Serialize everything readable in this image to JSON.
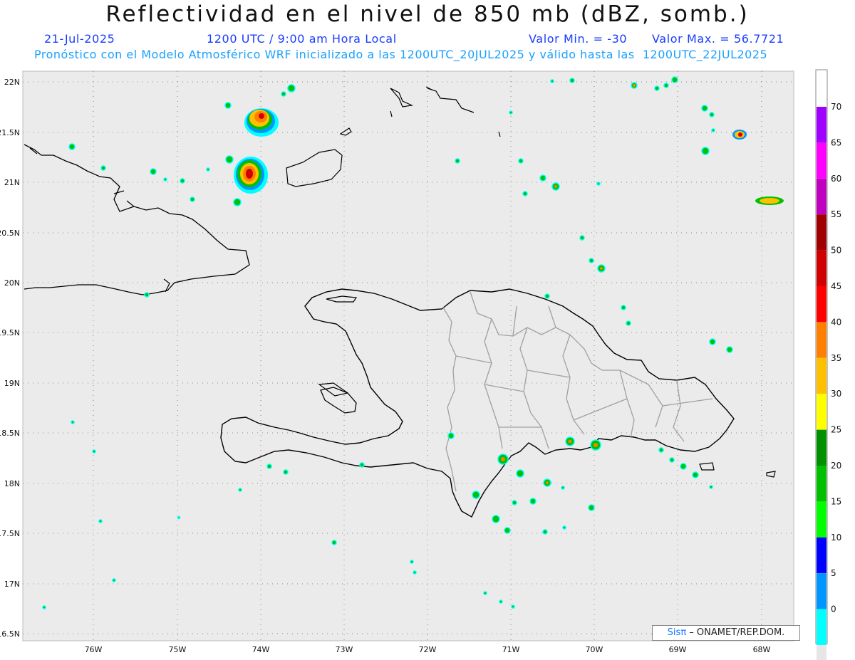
{
  "header": {
    "title": "Reflectividad en el nivel de 850 mb (dBZ, somb.)",
    "date": "21-Jul-2025",
    "time": "1200 UTC / 9:00 am Hora Local",
    "min_label": "Valor Min. = -30",
    "max_label": "Valor Max. = 56.7721",
    "forecast_info": "Pronóstico con el Modelo Atmosférico WRF inicializado a las 1200UTC_20JUL2025 y válido hasta las  1200UTC_22JUL2025"
  },
  "axes": {
    "lat_labels": [
      "22N",
      "21.5N",
      "21N",
      "20.5N",
      "20N",
      "19.5N",
      "19N",
      "18.5N",
      "18N",
      "17.5N",
      "17N",
      "16.5N"
    ],
    "lon_labels": [
      "76W",
      "75W",
      "74W",
      "73W",
      "72W",
      "71W",
      "70W",
      "69W",
      "68W"
    ]
  },
  "legend": {
    "labels": [
      "70",
      "65",
      "60",
      "55",
      "50",
      "45",
      "40",
      "35",
      "30",
      "25",
      "20",
      "15",
      "10",
      "5",
      "0"
    ],
    "colors": [
      "#a000ff",
      "#ff00ff",
      "#c000c0",
      "#a00000",
      "#d00000",
      "#ff0000",
      "#ff8000",
      "#ffc000",
      "#ffff00",
      "#009000",
      "#00c000",
      "#00ff00",
      "#0000ff",
      "#0096ff",
      "#00ffff",
      "#e6e6e6"
    ]
  },
  "credit": {
    "sis": "Sis",
    "pi": "π",
    "rest": "– ONAMET/REP.DOM."
  },
  "colors": {
    "map_background": "#ebebeb",
    "land_outline": "#000000",
    "province_lines": "#a0a0a0",
    "grid": "#888888"
  }
}
